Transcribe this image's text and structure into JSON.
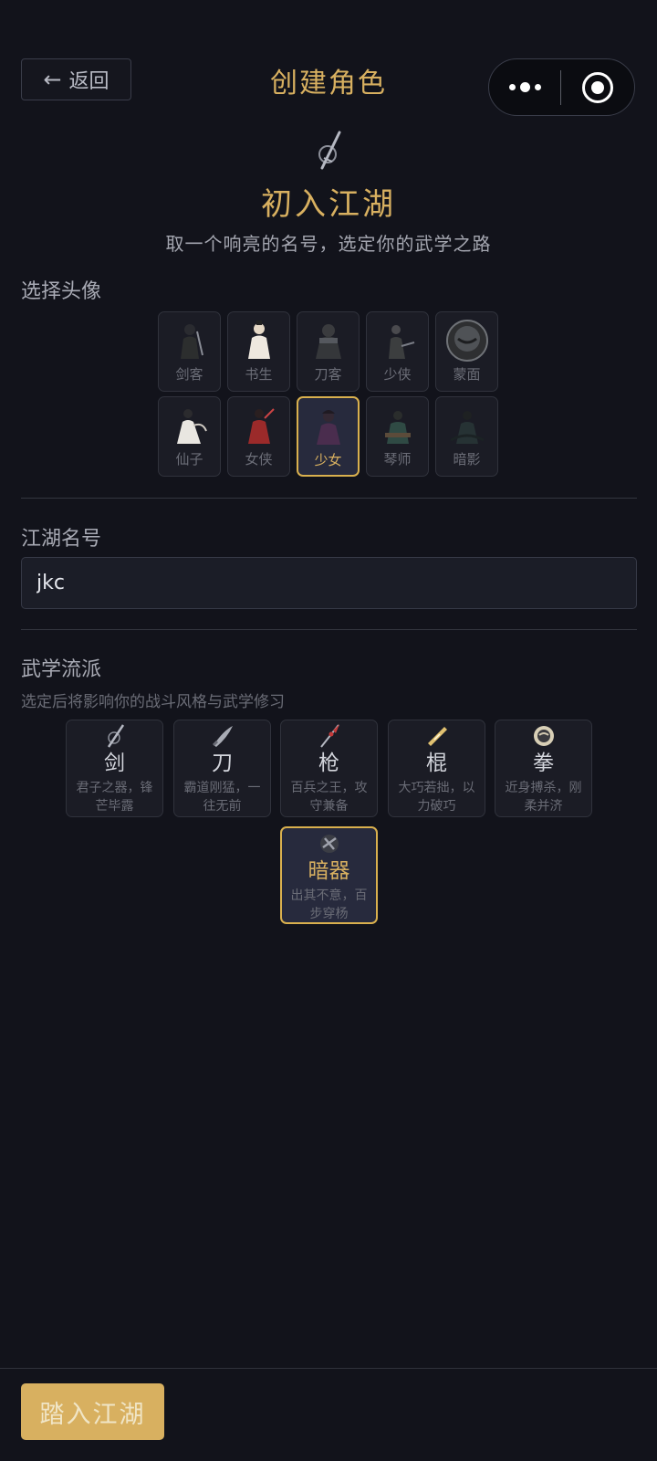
{
  "nav": {
    "back_label": "返回",
    "title": "创建角色"
  },
  "hero": {
    "title": "初入江湖",
    "subtitle": "取一个响亮的名号，选定你的武学之路"
  },
  "avatar_section": {
    "label": "选择头像",
    "selected": "少女",
    "items": [
      {
        "name": "剑客"
      },
      {
        "name": "书生"
      },
      {
        "name": "刀客"
      },
      {
        "name": "少侠"
      },
      {
        "name": "蒙面"
      },
      {
        "name": "仙子"
      },
      {
        "name": "女侠"
      },
      {
        "name": "少女"
      },
      {
        "name": "琴师"
      },
      {
        "name": "暗影"
      }
    ]
  },
  "name_section": {
    "label": "江湖名号",
    "value": "jkc"
  },
  "school_section": {
    "label": "武学流派",
    "hint": "选定后将影响你的战斗风格与武学修习",
    "selected": "暗器",
    "items": [
      {
        "name": "剑",
        "desc": "君子之器，锋芒毕露"
      },
      {
        "name": "刀",
        "desc": "霸道刚猛，一往无前"
      },
      {
        "name": "枪",
        "desc": "百兵之王，攻守兼备"
      },
      {
        "name": "棍",
        "desc": "大巧若拙，以力破巧"
      },
      {
        "name": "拳",
        "desc": "近身搏杀，刚柔并济"
      },
      {
        "name": "暗器",
        "desc": "出其不意，百步穿杨"
      }
    ]
  },
  "footer": {
    "enter_label": "踏入江湖"
  },
  "colors": {
    "accent": "#d8b060",
    "background": "#12131b",
    "card": "#1b1c25",
    "selected_card": "#272a3d"
  }
}
